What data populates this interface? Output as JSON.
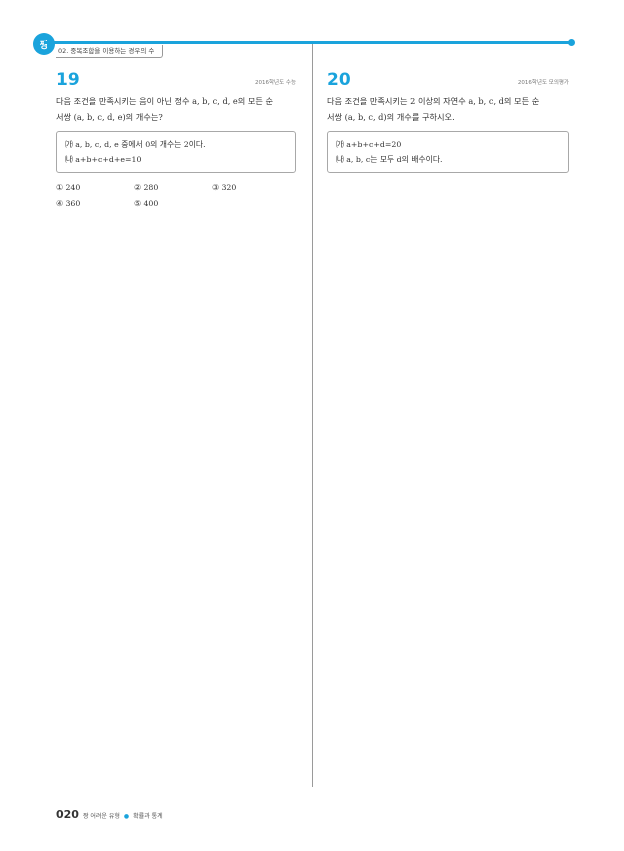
{
  "header": {
    "logo": "짱",
    "section_title": "02. 중복조합을 이용하는 경우의 수"
  },
  "problems": [
    {
      "number": "19",
      "source": "2016학년도 수능",
      "question_lines": [
        "다음 조건을 만족시키는 음이 아닌 정수 a, b, c, d, e의 모든 순",
        "서쌍 (a, b, c, d, e)의 개수는?"
      ],
      "conditions": [
        "㈎ a, b, c, d, e 중에서 0의 개수는 2이다.",
        "㈏ a+b+c+d+e=10"
      ],
      "choices": [
        "① 240",
        "② 280",
        "③ 320",
        "④ 360",
        "⑤ 400"
      ]
    },
    {
      "number": "20",
      "source": "2016학년도 모의평가",
      "question_lines": [
        "다음 조건을 만족시키는 2 이상의 자연수 a, b, c, d의 모든 순",
        "서쌍 (a, b, c, d)의 개수를 구하시오."
      ],
      "conditions": [
        "㈎ a+b+c+d=20",
        "㈏ a, b, c는 모두 d의 배수이다."
      ]
    }
  ],
  "footer": {
    "page_number": "020",
    "book_title": "짱 어려운 유형",
    "chapter": "확률과 통계"
  },
  "colors": {
    "accent": "#1aa3dc",
    "text": "#333333",
    "divider": "#9a9a9a"
  }
}
